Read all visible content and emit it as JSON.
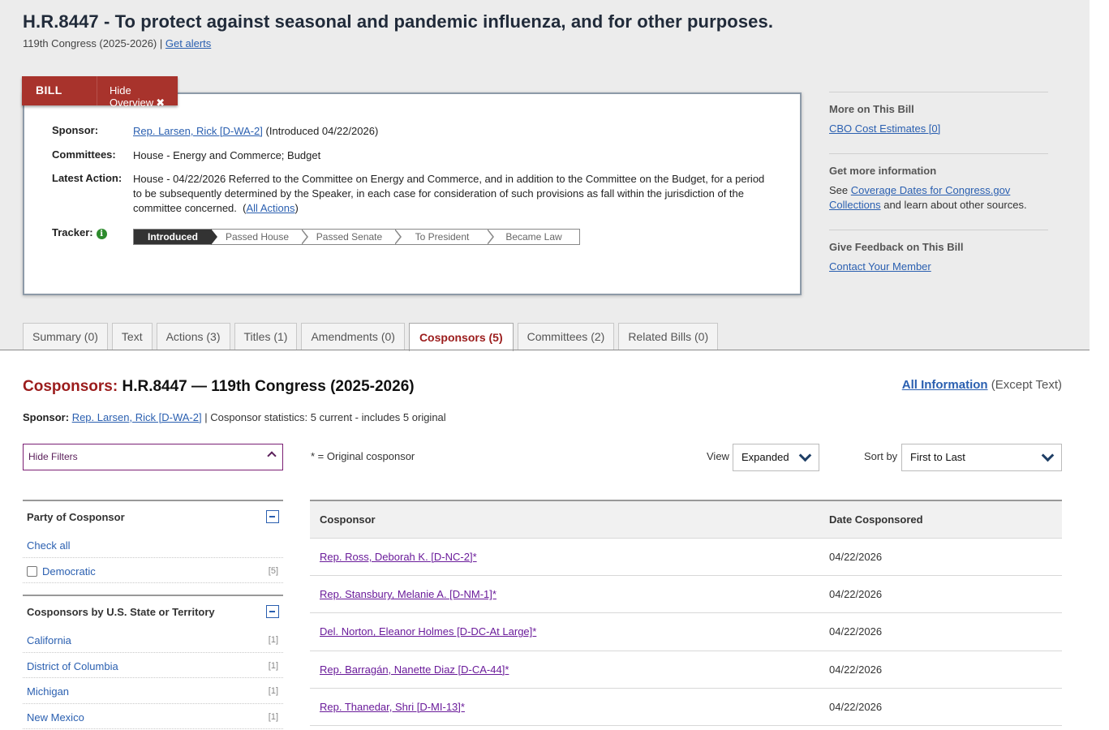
{
  "bill": {
    "title": "H.R.8447 - To protect against seasonal and pandemic influenza, and for other purposes.",
    "congress": "119th Congress (2025-2026)",
    "separator": "|",
    "get_alerts": "Get alerts"
  },
  "overview": {
    "tab_label": "BILL",
    "hide_label": "Hide Overview",
    "hide_icon": "✖",
    "sponsor_label": "Sponsor:",
    "sponsor_link": "Rep. Larsen, Rick [D-WA-2]",
    "sponsor_intro": "(Introduced 04/22/2026)",
    "committees_label": "Committees:",
    "committees_value": "House - Energy and Commerce; Budget",
    "latest_action_label": "Latest Action:",
    "latest_action_text": "House - 04/22/2026 Referred to the Committee on Energy and Commerce, and in addition to the Committee on the Budget, for a period to be subsequently determined by the Speaker, in each case for consideration of such provisions as fall within the jurisdiction of the committee concerned.",
    "all_actions_open": "(",
    "all_actions": "All Actions",
    "all_actions_close": ")",
    "tracker_label": "Tracker:",
    "tracker_steps": [
      "Introduced",
      "Passed House",
      "Passed Senate",
      "To President",
      "Became Law"
    ],
    "tracker_current": "Introduced"
  },
  "sidebar": {
    "more_heading": "More on This Bill",
    "cbo_link": "CBO Cost Estimates [0]",
    "info_heading": "Get more information",
    "info_prefix": "See",
    "info_link": "Coverage Dates for Congress.gov Collections",
    "info_suffix": "and learn about other sources.",
    "feedback_heading": "Give Feedback on This Bill",
    "contact_link": "Contact Your Member"
  },
  "tabs": [
    {
      "label": "Summary (0)"
    },
    {
      "label": "Text"
    },
    {
      "label": "Actions (3)"
    },
    {
      "label": "Titles (1)"
    },
    {
      "label": "Amendments (0)"
    },
    {
      "label": "Cosponsors (5)",
      "active": true
    },
    {
      "label": "Committees (2)"
    },
    {
      "label": "Related Bills (0)"
    }
  ],
  "cosponsors": {
    "heading_prefix": "Cosponsors:",
    "heading_rest": "H.R.8447 — 119th Congress (2025-2026)",
    "all_info_link": "All Information",
    "all_info_note": "(Except Text)",
    "sponsor_label": "Sponsor:",
    "sponsor_link": "Rep. Larsen, Rick [D-WA-2]",
    "stats": "| Cosponsor statistics: 5 current - includes 5 original",
    "hide_filters": "Hide Filters",
    "original_note": "* = Original cosponsor",
    "view_label": "View",
    "view_value": "Expanded",
    "sort_label": "Sort by",
    "sort_value": "First to Last",
    "col_cosponsor": "Cosponsor",
    "col_date": "Date Cosponsored",
    "rows": [
      {
        "name": "Rep. Ross, Deborah K. [D-NC-2]*",
        "date": "04/22/2026"
      },
      {
        "name": "Rep. Stansbury, Melanie A. [D-NM-1]*",
        "date": "04/22/2026"
      },
      {
        "name": "Del. Norton, Eleanor Holmes [D-DC-At Large]*",
        "date": "04/22/2026"
      },
      {
        "name": "Rep. Barragán, Nanette Diaz [D-CA-44]*",
        "date": "04/22/2026"
      },
      {
        "name": "Rep. Thanedar, Shri [D-MI-13]*",
        "date": "04/22/2026"
      }
    ]
  },
  "filters": {
    "party": {
      "heading": "Party of Cosponsor",
      "check_all": "Check all",
      "items": [
        {
          "label": "Democratic",
          "count": "[5]"
        }
      ]
    },
    "state": {
      "heading": "Cosponsors by U.S. State or Territory",
      "items": [
        {
          "label": "California",
          "count": "[1]"
        },
        {
          "label": "District of Columbia",
          "count": "[1]"
        },
        {
          "label": "Michigan",
          "count": "[1]"
        },
        {
          "label": "New Mexico",
          "count": "[1]"
        }
      ]
    }
  }
}
